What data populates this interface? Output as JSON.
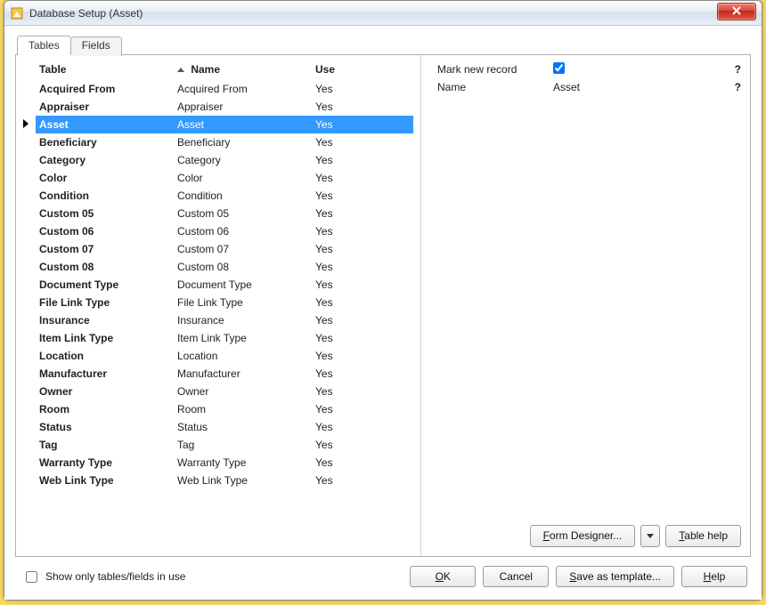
{
  "window": {
    "title": "Database Setup (Asset)"
  },
  "tabs": {
    "tables": "Tables",
    "fields": "Fields"
  },
  "grid": {
    "headers": {
      "table": "Table",
      "name": "Name",
      "use": "Use"
    },
    "rows": [
      {
        "table": "Acquired From",
        "name": "Acquired From",
        "use": "Yes",
        "selected": false
      },
      {
        "table": "Appraiser",
        "name": "Appraiser",
        "use": "Yes",
        "selected": false
      },
      {
        "table": "Asset",
        "name": "Asset",
        "use": "Yes",
        "selected": true
      },
      {
        "table": "Beneficiary",
        "name": "Beneficiary",
        "use": "Yes",
        "selected": false
      },
      {
        "table": "Category",
        "name": "Category",
        "use": "Yes",
        "selected": false
      },
      {
        "table": "Color",
        "name": "Color",
        "use": "Yes",
        "selected": false
      },
      {
        "table": "Condition",
        "name": "Condition",
        "use": "Yes",
        "selected": false
      },
      {
        "table": "Custom 05",
        "name": "Custom 05",
        "use": "Yes",
        "selected": false
      },
      {
        "table": "Custom 06",
        "name": "Custom 06",
        "use": "Yes",
        "selected": false
      },
      {
        "table": "Custom 07",
        "name": "Custom 07",
        "use": "Yes",
        "selected": false
      },
      {
        "table": "Custom 08",
        "name": "Custom 08",
        "use": "Yes",
        "selected": false
      },
      {
        "table": "Document Type",
        "name": "Document Type",
        "use": "Yes",
        "selected": false
      },
      {
        "table": "File Link Type",
        "name": "File Link Type",
        "use": "Yes",
        "selected": false
      },
      {
        "table": "Insurance",
        "name": "Insurance",
        "use": "Yes",
        "selected": false
      },
      {
        "table": "Item Link Type",
        "name": "Item Link Type",
        "use": "Yes",
        "selected": false
      },
      {
        "table": "Location",
        "name": "Location",
        "use": "Yes",
        "selected": false
      },
      {
        "table": "Manufacturer",
        "name": "Manufacturer",
        "use": "Yes",
        "selected": false
      },
      {
        "table": "Owner",
        "name": "Owner",
        "use": "Yes",
        "selected": false
      },
      {
        "table": "Room",
        "name": "Room",
        "use": "Yes",
        "selected": false
      },
      {
        "table": "Status",
        "name": "Status",
        "use": "Yes",
        "selected": false
      },
      {
        "table": "Tag",
        "name": "Tag",
        "use": "Yes",
        "selected": false
      },
      {
        "table": "Warranty Type",
        "name": "Warranty Type",
        "use": "Yes",
        "selected": false
      },
      {
        "table": "Web Link Type",
        "name": "Web Link Type",
        "use": "Yes",
        "selected": false
      }
    ]
  },
  "props": {
    "mark_label": "Mark new record",
    "mark_checked": true,
    "name_label": "Name",
    "name_value": "Asset",
    "help_glyph": "?"
  },
  "right_buttons": {
    "form_designer": "Form Designer...",
    "table_help": "Table help"
  },
  "bottom": {
    "show_only_label": "Show only tables/fields in use",
    "show_only_checked": false,
    "ok": "OK",
    "cancel": "Cancel",
    "save_as_template": "Save as template...",
    "help": "Help"
  }
}
